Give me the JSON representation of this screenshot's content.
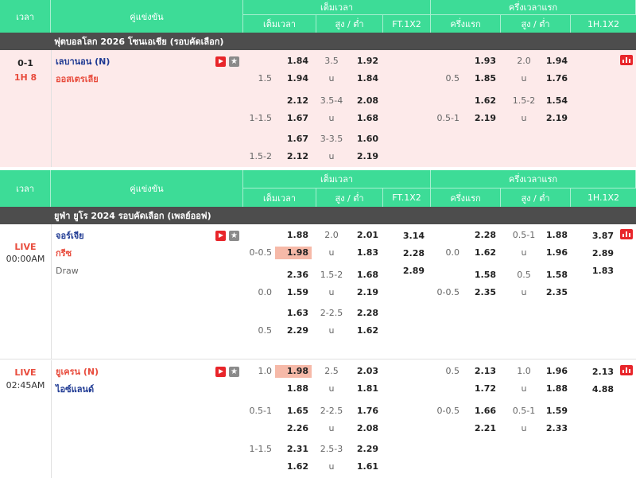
{
  "header": {
    "time": "เวลา",
    "match": "คู่แข่งขัน",
    "fulltime": "เต็มเวลา",
    "firsthalf": "ครึ่งเวลาแรก",
    "ft_hdp": "เต็มเวลา",
    "ft_ou": "สูง / ต่ำ",
    "ft_1x2": "FT.1X2",
    "h1_hdp": "ครึ่งแรก",
    "h1_ou": "สูง / ต่ำ",
    "h1_1x2": "1H.1X2"
  },
  "leagues": [
    {
      "name": "ฟุตบอลโลก 2026 โซนเอเชีย (รอบคัดเลือก)"
    },
    {
      "name": "ยูฟ่า ยูโร 2024 รอบคัดเลือก (เพลย์ออฟ)"
    }
  ],
  "match1": {
    "score": "0-1",
    "status": "1H 8",
    "home": "เลบานอน (N)",
    "away": "ออสเตรเลีย",
    "rows": [
      {
        "ft_line": "",
        "ft_h": "1.84",
        "ou_line": "3.5",
        "ou_o": "1.92",
        "h1_line": "",
        "h1_h": "1.93",
        "h1ou_line": "2.0",
        "h1ou_o": "1.94"
      },
      {
        "ft_line": "1.5",
        "ft_h": "1.94",
        "ou_line": "u",
        "ou_o": "1.84",
        "h1_line": "0.5",
        "h1_h": "1.85",
        "h1ou_line": "u",
        "h1ou_o": "1.76"
      },
      {
        "ft_line": "",
        "ft_h": "2.12",
        "ou_line": "3.5-4",
        "ou_o": "2.08",
        "h1_line": "",
        "h1_h": "1.62",
        "h1ou_line": "1.5-2",
        "h1ou_o": "1.54"
      },
      {
        "ft_line": "1-1.5",
        "ft_h": "1.67",
        "ou_line": "u",
        "ou_o": "1.68",
        "h1_line": "0.5-1",
        "h1_h": "2.19",
        "h1ou_line": "u",
        "h1ou_o": "2.19"
      },
      {
        "ft_line": "",
        "ft_h": "1.67",
        "ou_line": "3-3.5",
        "ou_o": "1.60",
        "h1_line": "",
        "h1_h": "",
        "h1ou_line": "",
        "h1ou_o": ""
      },
      {
        "ft_line": "1.5-2",
        "ft_h": "2.12",
        "ou_line": "u",
        "ou_o": "2.19",
        "h1_line": "",
        "h1_h": "",
        "h1ou_line": "",
        "h1ou_o": ""
      }
    ]
  },
  "match2": {
    "live": "LIVE",
    "time": "00:00AM",
    "home": "จอร์เจีย",
    "away": "กรีซ",
    "draw": "Draw",
    "ft1x2": [
      "3.14",
      "2.28",
      "2.89"
    ],
    "h11x2": [
      "3.87",
      "2.89",
      "1.83"
    ],
    "rows": [
      {
        "ft_line": "",
        "ft_h": "1.88",
        "ou_line": "2.0",
        "ou_o": "2.01",
        "h1_line": "",
        "h1_h": "2.28",
        "h1ou_line": "0.5-1",
        "h1ou_o": "1.88"
      },
      {
        "ft_line": "0-0.5",
        "ft_h": "1.98",
        "ou_line": "u",
        "ou_o": "1.83",
        "h1_line": "0.0",
        "h1_h": "1.62",
        "h1ou_line": "u",
        "h1ou_o": "1.96"
      },
      {
        "ft_line": "",
        "ft_h": "2.36",
        "ou_line": "1.5-2",
        "ou_o": "1.68",
        "h1_line": "",
        "h1_h": "1.58",
        "h1ou_line": "0.5",
        "h1ou_o": "1.58"
      },
      {
        "ft_line": "0.0",
        "ft_h": "1.59",
        "ou_line": "u",
        "ou_o": "2.19",
        "h1_line": "0-0.5",
        "h1_h": "2.35",
        "h1ou_line": "u",
        "h1ou_o": "2.35"
      },
      {
        "ft_line": "",
        "ft_h": "1.63",
        "ou_line": "2-2.5",
        "ou_o": "2.28",
        "h1_line": "",
        "h1_h": "",
        "h1ou_line": "",
        "h1ou_o": ""
      },
      {
        "ft_line": "0.5",
        "ft_h": "2.29",
        "ou_line": "u",
        "ou_o": "1.62",
        "h1_line": "",
        "h1_h": "",
        "h1ou_line": "",
        "h1ou_o": ""
      }
    ]
  },
  "match3": {
    "live": "LIVE",
    "time": "02:45AM",
    "home": "ยูเครน (N)",
    "away": "ไอซ์แลนด์",
    "h11x2": [
      "2.13",
      "4.88"
    ],
    "rows": [
      {
        "ft_line": "1.0",
        "ft_h": "1.98",
        "ou_line": "2.5",
        "ou_o": "2.03",
        "h1_line": "0.5",
        "h1_h": "2.13",
        "h1ou_line": "1.0",
        "h1ou_o": "1.96"
      },
      {
        "ft_line": "",
        "ft_h": "1.88",
        "ou_line": "u",
        "ou_o": "1.81",
        "h1_line": "",
        "h1_h": "1.72",
        "h1ou_line": "u",
        "h1ou_o": "1.88"
      },
      {
        "ft_line": "0.5-1",
        "ft_h": "1.65",
        "ou_line": "2-2.5",
        "ou_o": "1.76",
        "h1_line": "0-0.5",
        "h1_h": "1.66",
        "h1ou_line": "0.5-1",
        "h1ou_o": "1.59"
      },
      {
        "ft_line": "",
        "ft_h": "2.26",
        "ou_line": "u",
        "ou_o": "2.08",
        "h1_line": "",
        "h1_h": "2.21",
        "h1ou_line": "u",
        "h1ou_o": "2.33"
      },
      {
        "ft_line": "1-1.5",
        "ft_h": "2.31",
        "ou_line": "2.5-3",
        "ou_o": "2.29",
        "h1_line": "",
        "h1_h": "",
        "h1ou_line": "",
        "h1ou_o": ""
      },
      {
        "ft_line": "",
        "ft_h": "1.62",
        "ou_line": "u",
        "ou_o": "1.61",
        "h1_line": "",
        "h1_h": "",
        "h1ou_line": "",
        "h1ou_o": ""
      }
    ]
  },
  "icons": {
    "play": "play-video-icon",
    "star": "favorite-star-icon",
    "chart": "stats-chart-icon"
  },
  "colors": {
    "header": "#3ddc97",
    "league_bar": "#4d4d4d",
    "live_row": "#fdeaea",
    "accent": "#e8252a",
    "highlight": "#f6b9a8"
  }
}
